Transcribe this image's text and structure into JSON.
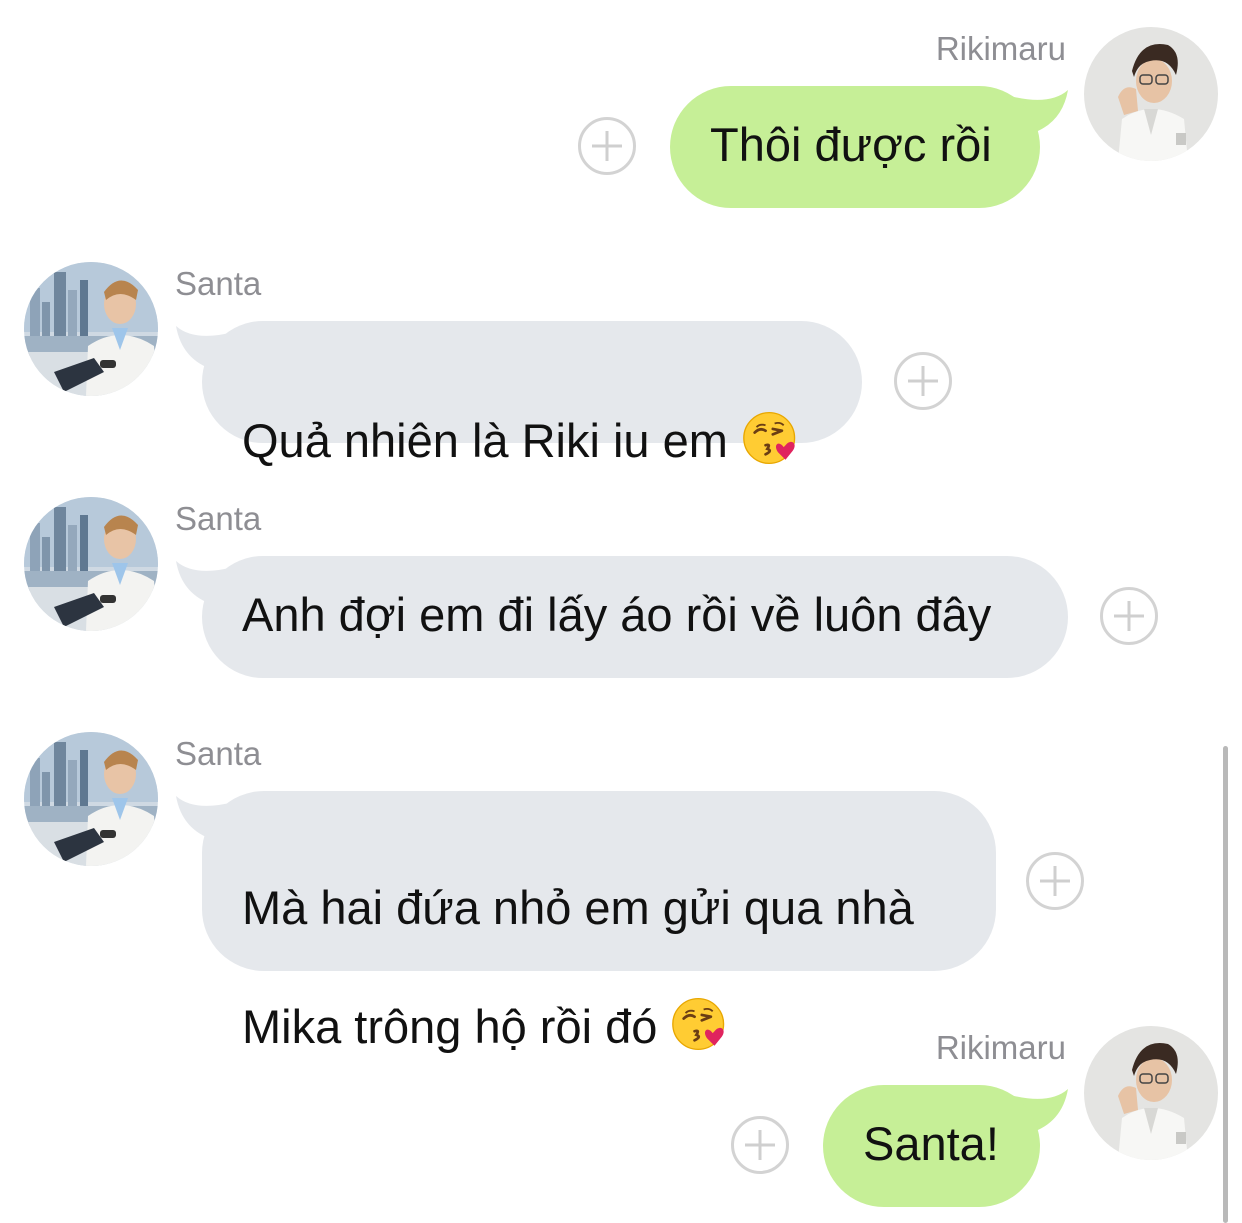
{
  "chat": {
    "messages": [
      {
        "sender": "Rikimaru",
        "text": "Thôi được rồi",
        "direction": "outgoing",
        "avatar": "rikimaru-avatar"
      },
      {
        "sender": "Santa",
        "text": "Quả nhiên là Riki iu em",
        "emoji": "kissing-face-emoji",
        "direction": "incoming",
        "avatar": "santa-avatar"
      },
      {
        "sender": "Santa",
        "text": "Anh đợi em đi lấy áo rồi về luôn đây",
        "direction": "incoming",
        "avatar": "santa-avatar"
      },
      {
        "sender": "Santa",
        "text_line1": "Mà hai đứa nhỏ em gửi qua nhà",
        "text_line2": "Mika trông hộ rồi đó",
        "emoji": "kissing-face-emoji",
        "direction": "incoming",
        "avatar": "santa-avatar"
      },
      {
        "sender": "Rikimaru",
        "text": "Santa!",
        "direction": "outgoing",
        "avatar": "rikimaru-avatar"
      }
    ]
  },
  "colors": {
    "incoming_bubble": "#e5e8ec",
    "outgoing_bubble": "#c6ef97",
    "sender_name": "#8e8e93",
    "add_reaction_icon": "#d3d3d3"
  }
}
